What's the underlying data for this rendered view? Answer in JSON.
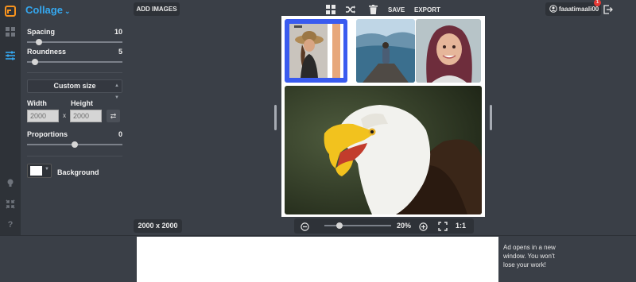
{
  "app": {
    "title": "Collage"
  },
  "rail": {
    "icons": [
      "layout-grid-icon",
      "sliders-icon",
      "lightbulb-icon",
      "shrink-icon",
      "help-icon"
    ]
  },
  "settings": {
    "spacing": {
      "label": "Spacing",
      "value": "10",
      "level": 0.1
    },
    "roundness": {
      "label": "Roundness",
      "value": "5",
      "level": 0.05
    },
    "size_mode": "Custom size",
    "width": {
      "label": "Width",
      "value": "2000"
    },
    "height": {
      "label": "Height",
      "value": "2000"
    },
    "times_sign": "x",
    "proportions": {
      "label": "Proportions",
      "value": "0",
      "level": 0.5
    },
    "background": {
      "label": "Background",
      "color": "#ffffff"
    }
  },
  "toolbar": {
    "add_images": "ADD IMAGES",
    "save": "SAVE",
    "export": "EXPORT"
  },
  "user": {
    "name": "faaatimaali00",
    "notifications": "1"
  },
  "canvas": {
    "dimensions": "2000 x 2000",
    "zoom": "20%",
    "zoom_level": 0.2,
    "actual_size": "1:1"
  },
  "ad": {
    "note": "Ad opens in a new window. You won't lose your work!"
  },
  "colors": {
    "accent": "#35a8f0",
    "panel": "#3a3f47",
    "dark": "#2e3238",
    "selected": "#3a5bef",
    "badge": "#e53935"
  }
}
